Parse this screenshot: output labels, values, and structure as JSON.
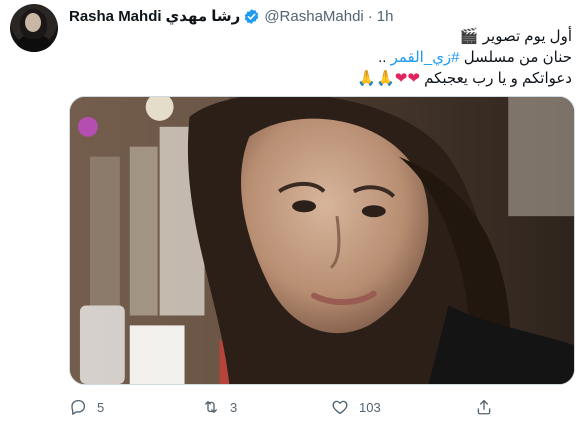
{
  "tweet": {
    "author_name": "Rasha Mahdi",
    "author_name_arabic": "رشا مهدي",
    "handle": "@RashaMahdi",
    "separator": "·",
    "time": "1h",
    "lines": {
      "line1": "أول يوم تصوير 🎬",
      "line2_prefix": "حنان من مسلسل ",
      "hashtag": "#زي_القمر",
      "line2_suffix": " ..",
      "line3_text": "دعواتكم و يا رب يعجبكم ",
      "hearts": "❤❤",
      "prayers": "🙏🙏"
    }
  },
  "actions": {
    "reply_count": "5",
    "retweet_count": "3",
    "like_count": "103"
  },
  "colors": {
    "accent": "#1d9bf0",
    "muted": "#536471",
    "heart": "#e0245e"
  }
}
